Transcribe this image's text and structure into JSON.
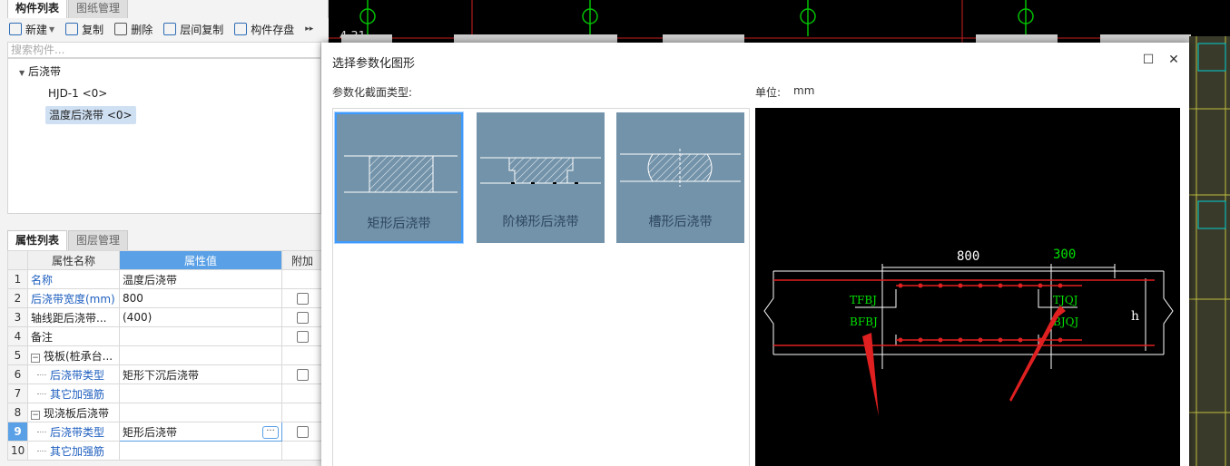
{
  "left_panel": {
    "tabs": [
      "构件列表",
      "图纸管理"
    ],
    "toolbar": {
      "new": "新建",
      "copy": "复制",
      "delete": "删除",
      "floor_copy": "层间复制",
      "save": "构件存盘"
    },
    "search_placeholder": "搜索构件...",
    "tree": {
      "root": "后浇带",
      "items": [
        "HJD-1 <0>",
        "温度后浇带 <0>"
      ]
    },
    "prop_tabs": [
      "属性列表",
      "图层管理"
    ],
    "prop_table": {
      "headers": [
        "属性名称",
        "属性值",
        "附加"
      ],
      "rows": [
        {
          "num": "1",
          "name": "名称",
          "value": "温度后浇带"
        },
        {
          "num": "2",
          "name": "后浇带宽度(mm)",
          "value": "800"
        },
        {
          "num": "3",
          "name": "轴线距后浇带...",
          "value": "(400)"
        },
        {
          "num": "4",
          "name": "备注",
          "value": ""
        },
        {
          "num": "5",
          "name": "筏板(桩承台...",
          "value": ""
        },
        {
          "num": "6",
          "name": "后浇带类型",
          "value": "矩形下沉后浇带"
        },
        {
          "num": "7",
          "name": "其它加强筋",
          "value": ""
        },
        {
          "num": "8",
          "name": "现浇板后浇带",
          "value": ""
        },
        {
          "num": "9",
          "name": "后浇带类型",
          "value": "矩形后浇带"
        },
        {
          "num": "10",
          "name": "其它加强筋",
          "value": ""
        }
      ]
    }
  },
  "dialog": {
    "title": "选择参数化图形",
    "section_label": "参数化截面类型:",
    "unit_label": "单位:",
    "unit_value": "mm",
    "shapes": [
      "矩形后浇带",
      "阶梯形后浇带",
      "槽形后浇带"
    ],
    "preview": {
      "dim_width": "800",
      "dim_offset": "300",
      "label_tfbj": "TFBJ",
      "label_bfbj": "BFBJ",
      "label_tjqj": "TJQJ",
      "label_bjqj": "BJQJ",
      "label_h": "h"
    }
  },
  "cad_bg": {
    "label": "4.31"
  },
  "colors": {
    "accent": "#5aa0e6",
    "shape_bg": "#7393aa",
    "cad_green": "#00e000",
    "cad_red": "#e02020"
  }
}
